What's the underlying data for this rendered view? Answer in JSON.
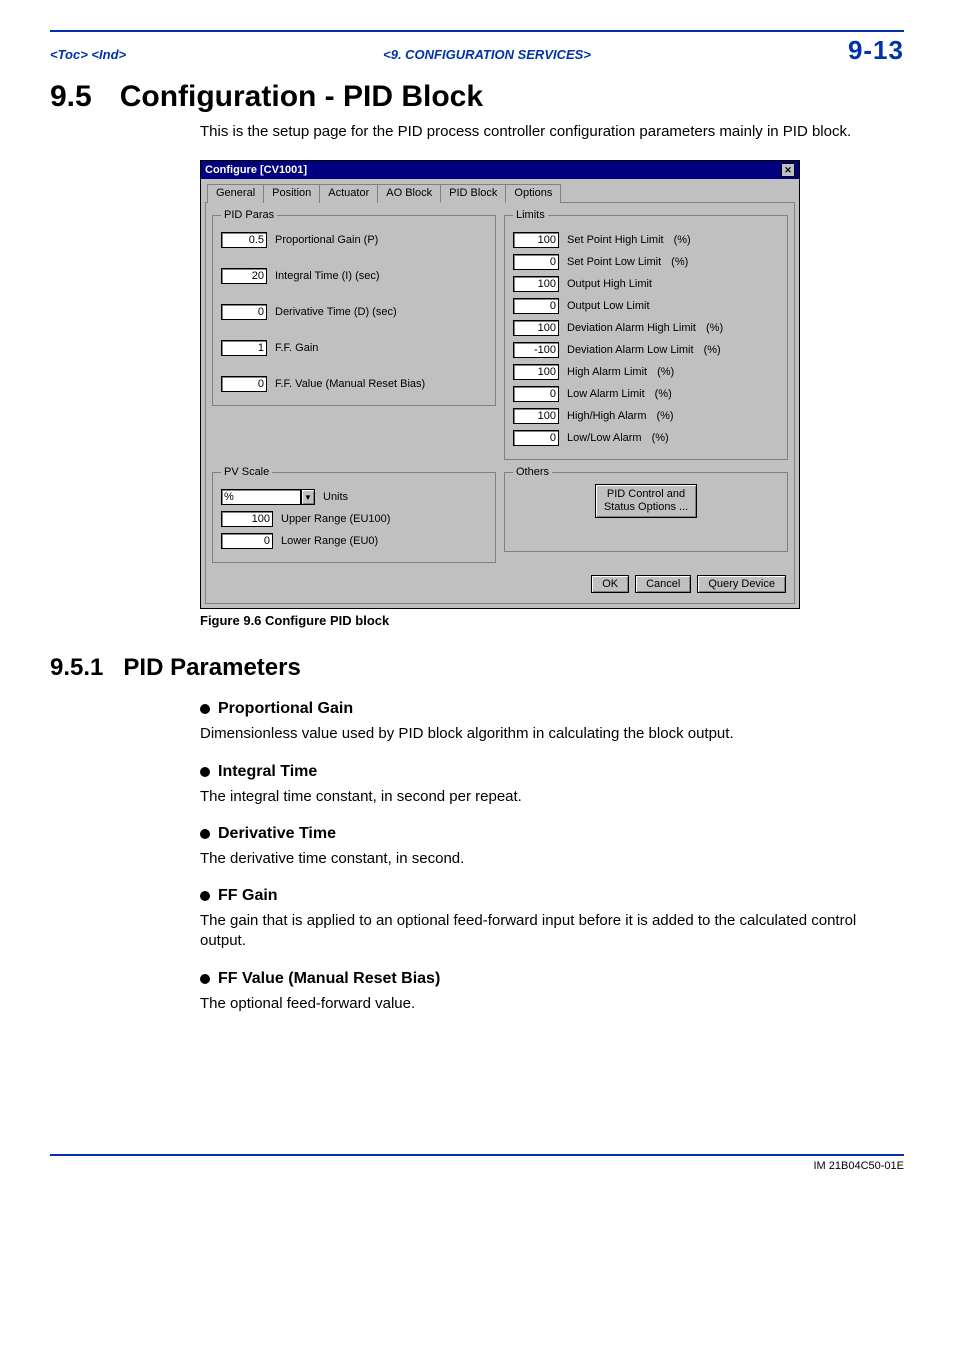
{
  "header": {
    "left": "<Toc> <Ind>",
    "center": "<9.  CONFIGURATION SERVICES>",
    "right": "9-13"
  },
  "section": {
    "num": "9.5",
    "title": "Configuration - PID Block",
    "intro": "This is the setup page for the PID process controller configuration parameters mainly in PID block."
  },
  "dialog": {
    "title": "Configure [CV1001]",
    "tabs": [
      "General",
      "Position",
      "Actuator",
      "AO Block",
      "PID Block",
      "Options"
    ],
    "active_tab": "PID Block",
    "pid_paras": {
      "legend": "PID Paras",
      "rows": [
        {
          "value": "0.5",
          "label": "Proportional Gain (P)"
        },
        {
          "value": "20",
          "label": "Integral Time (I) (sec)"
        },
        {
          "value": "0",
          "label": "Derivative Time (D) (sec)"
        },
        {
          "value": "1",
          "label": "F.F. Gain"
        },
        {
          "value": "0",
          "label": "F.F. Value (Manual Reset Bias)"
        }
      ]
    },
    "limits": {
      "legend": "Limits",
      "rows": [
        {
          "value": "100",
          "label": "Set Point High Limit",
          "unit": "(%)"
        },
        {
          "value": "0",
          "label": "Set Point Low Limit",
          "unit": "(%)"
        },
        {
          "value": "100",
          "label": "Output High Limit",
          "unit": ""
        },
        {
          "value": "0",
          "label": "Output Low Limit",
          "unit": ""
        },
        {
          "value": "100",
          "label": "Deviation Alarm High Limit",
          "unit": "(%)"
        },
        {
          "value": "-100",
          "label": "Deviation Alarm Low Limit",
          "unit": "(%)"
        },
        {
          "value": "100",
          "label": "High Alarm Limit",
          "unit": "(%)"
        },
        {
          "value": "0",
          "label": "Low Alarm Limit",
          "unit": "(%)"
        },
        {
          "value": "100",
          "label": "High/High Alarm",
          "unit": "(%)"
        },
        {
          "value": "0",
          "label": "Low/Low Alarm",
          "unit": "(%)"
        }
      ]
    },
    "pv_scale": {
      "legend": "PV Scale",
      "unit_value": "%",
      "unit_label": "Units",
      "upper_value": "100",
      "upper_label": "Upper Range (EU100)",
      "lower_value": "0",
      "lower_label": "Lower Range (EU0)"
    },
    "others": {
      "legend": "Others",
      "button_l1": "PID Control and",
      "button_l2": "Status Options ..."
    },
    "buttons": {
      "ok": "OK",
      "cancel": "Cancel",
      "query": "Query Device"
    }
  },
  "figure_caption": "Figure 9.6  Configure PID block",
  "subsection": {
    "num": "9.5.1",
    "title": "PID Parameters",
    "items": [
      {
        "h": "Proportional Gain",
        "p": "Dimensionless value used by PID block algorithm in calculating the block output."
      },
      {
        "h": "Integral Time",
        "p": "The integral time constant, in second per repeat."
      },
      {
        "h": "Derivative Time",
        "p": "The derivative time constant, in second."
      },
      {
        "h": "FF Gain",
        "p": "The gain that is applied to an optional feed-forward input before it is added to the calculated control output."
      },
      {
        "h": "FF Value (Manual Reset Bias)",
        "p": "The optional feed-forward value."
      }
    ]
  },
  "footer": "IM 21B04C50-01E"
}
